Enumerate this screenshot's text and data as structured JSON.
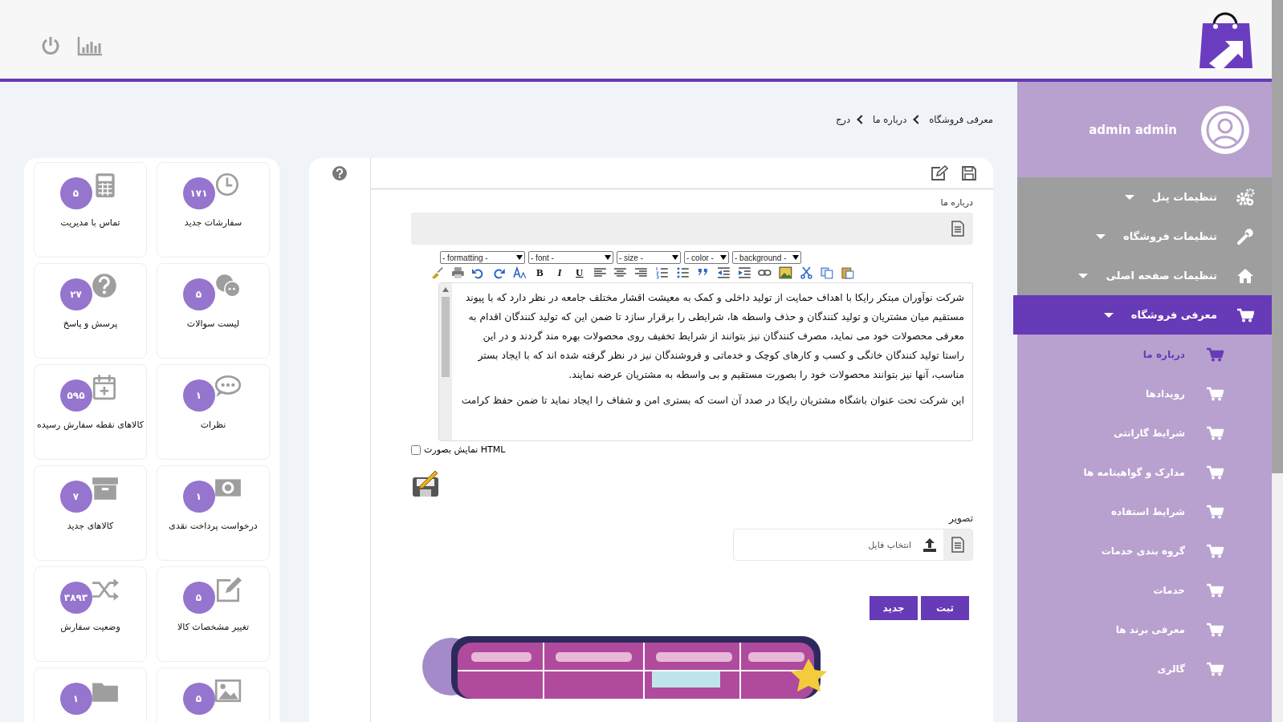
{
  "header": {
    "user_name": "admin admin"
  },
  "breadcrumb": [
    "معرفی فروشگاه",
    "درباره ما",
    "درج"
  ],
  "menu": [
    {
      "label": "تنظیمات پنل",
      "selected": false
    },
    {
      "label": "تنظیمات فروشگاه",
      "selected": false
    },
    {
      "label": "تنظیمات صفحه اصلی",
      "selected": false
    },
    {
      "label": "معرفی فروشگاه",
      "selected": true,
      "children": [
        {
          "label": "درباره ما",
          "selected": true
        },
        {
          "label": "رویدادها",
          "selected": false
        },
        {
          "label": "شرایط گارانتی",
          "selected": false
        },
        {
          "label": "مدارک و گواهینامه ها",
          "selected": false
        },
        {
          "label": "شرایط استفاده",
          "selected": false
        },
        {
          "label": "گروه بندی خدمات",
          "selected": false
        },
        {
          "label": "خدمات",
          "selected": false
        },
        {
          "label": "معرفی برند ها",
          "selected": false
        },
        {
          "label": "گالری",
          "selected": false
        }
      ]
    }
  ],
  "form": {
    "field_label": "درباره ما",
    "editor": {
      "selects": [
        "- background -",
        "- color -",
        "- size -",
        "- font -",
        "- formatting -"
      ],
      "format_buttons": [
        "U",
        "I",
        "B"
      ],
      "paragraphs": [
        "شرکت نوآوران مبتکر رایکا با اهداف حمایت از تولید داخلی و کمک  به معیشت اقشار مختلف جامعه در نظر دارد که با پیوند مستقیم میان مشتریان و تولید کنندگان و حذف واسطه ها، شرایطی را برقرار سازد تا ضمن این که تولید کنندگان اقدام به معرفی محصولات خود می نماید، مصرف کنندگان نیز بتوانند از شرایط تخفیف روی محصولات بهره مند گردند و در این راستا تولید کنندگان خانگی و کسب و کارهای کوچک و خدماتی و فروشندگان نیز در نظر گرفته شده اند که با ایجاد بستر مناسب، آنها نیز بتوانند محصولات خود را بصورت مستقیم و بی واسطه به مشتریان عرضه نمایند.",
        "این شرکت تحت عنوان باشگاه مشتریان رایکا در صدد آن است که بستری امن و شفاف را ایجاد نماید تا ضمن حفظ کرامت"
      ]
    },
    "html_toggle": {
      "label": "نمایش بصورت HTML",
      "checked": false
    },
    "image_label": "تصویر",
    "file_picker": {
      "placeholder": "انتخاب فایل"
    },
    "buttons": [
      "ثبت",
      "جدید"
    ]
  },
  "cards": [
    {
      "label": "سفارشات جدید",
      "count": "۱۷۱"
    },
    {
      "label": "تماس با مدیریت",
      "count": "۵"
    },
    {
      "label": "لیست سوالات",
      "count": "۵"
    },
    {
      "label": "پرسش و پاسخ",
      "count": "۲۷"
    },
    {
      "label": "نظرات",
      "count": "۱"
    },
    {
      "label": "کالاهای نقطه سفارش رسیده",
      "count": "۵۹۵"
    },
    {
      "label": "درخواست پرداخت نقدی",
      "count": "۱"
    },
    {
      "label": "کالاهای جدید",
      "count": "۷"
    },
    {
      "label": "تغییر مشخصات کالا",
      "count": "۵"
    },
    {
      "label": "وضعیت سفارش",
      "count": "۳۸۹۳"
    },
    {
      "count": "۵"
    },
    {
      "count": "۱"
    }
  ]
}
